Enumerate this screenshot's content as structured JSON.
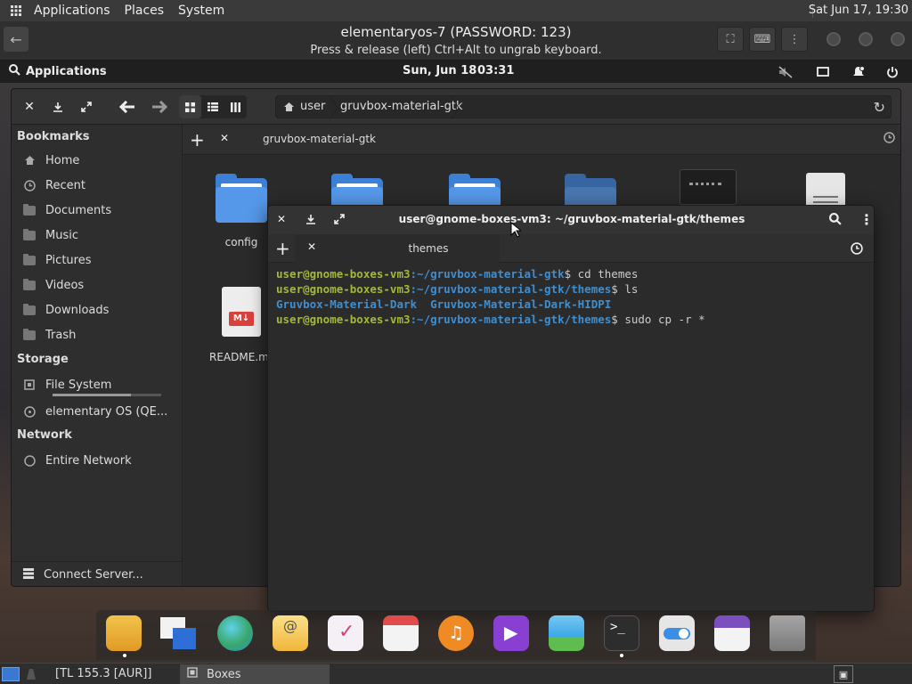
{
  "host_panel": {
    "menus": [
      "Applications",
      "Places",
      "System"
    ],
    "clock": "Sat Jun 17, 19:30"
  },
  "boxes": {
    "title": "elementaryos-7 (PASSWORD: 123)",
    "subtitle": "Press & release (left) Ctrl+Alt to ungrab keyboard."
  },
  "guest_panel": {
    "apps_label": "Applications",
    "date": "Sun, Jun 18",
    "time": "03:31"
  },
  "files": {
    "path": [
      "user",
      "gruvbox-material-gtk"
    ],
    "tab_label": "gruvbox-material-gtk",
    "sidebar": {
      "bookmarks_heading": "Bookmarks",
      "bookmarks": [
        "Home",
        "Recent",
        "Documents",
        "Music",
        "Pictures",
        "Videos",
        "Downloads",
        "Trash"
      ],
      "storage_heading": "Storage",
      "storage": [
        "File System",
        "elementary OS (QE..."
      ],
      "filesystem_usage": 0.72,
      "network_heading": "Network",
      "network": [
        "Entire Network"
      ],
      "connect_server": "Connect Server..."
    },
    "items": [
      "config",
      "README.m"
    ]
  },
  "terminal": {
    "title": "user@gnome-boxes-vm3: ~/gruvbox-material-gtk/themes",
    "tab_label": "themes",
    "lines": [
      {
        "user": "user@gnome-boxes-vm3",
        "path": ":~/gruvbox-material-gtk",
        "cmd": "$ cd themes"
      },
      {
        "user": "user@gnome-boxes-vm3",
        "path": ":~/gruvbox-material-gtk/themes",
        "cmd": "$ ls"
      },
      {
        "output": "Gruvbox-Material-Dark  Gruvbox-Material-Dark-HIDPI"
      },
      {
        "user": "user@gnome-boxes-vm3",
        "path": ":~/gruvbox-material-gtk/themes",
        "cmd": "$ sudo cp -r *"
      }
    ]
  },
  "dock": {
    "apps": [
      "files-icon",
      "multitasking-icon",
      "web-browser-icon",
      "mail-icon",
      "tasks-icon",
      "calendar-icon",
      "music-icon",
      "videos-icon",
      "photos-icon",
      "terminal-icon",
      "settings-icon",
      "appcenter-icon",
      "trash-icon"
    ]
  },
  "taskbar": {
    "tl_label": "[TL 155.3 [AUR]]",
    "boxes_label": "Boxes"
  },
  "colors": {
    "prompt_user": "#a3b83c",
    "prompt_path": "#3f8fd0",
    "folder_blue": "#3c7fd6"
  }
}
